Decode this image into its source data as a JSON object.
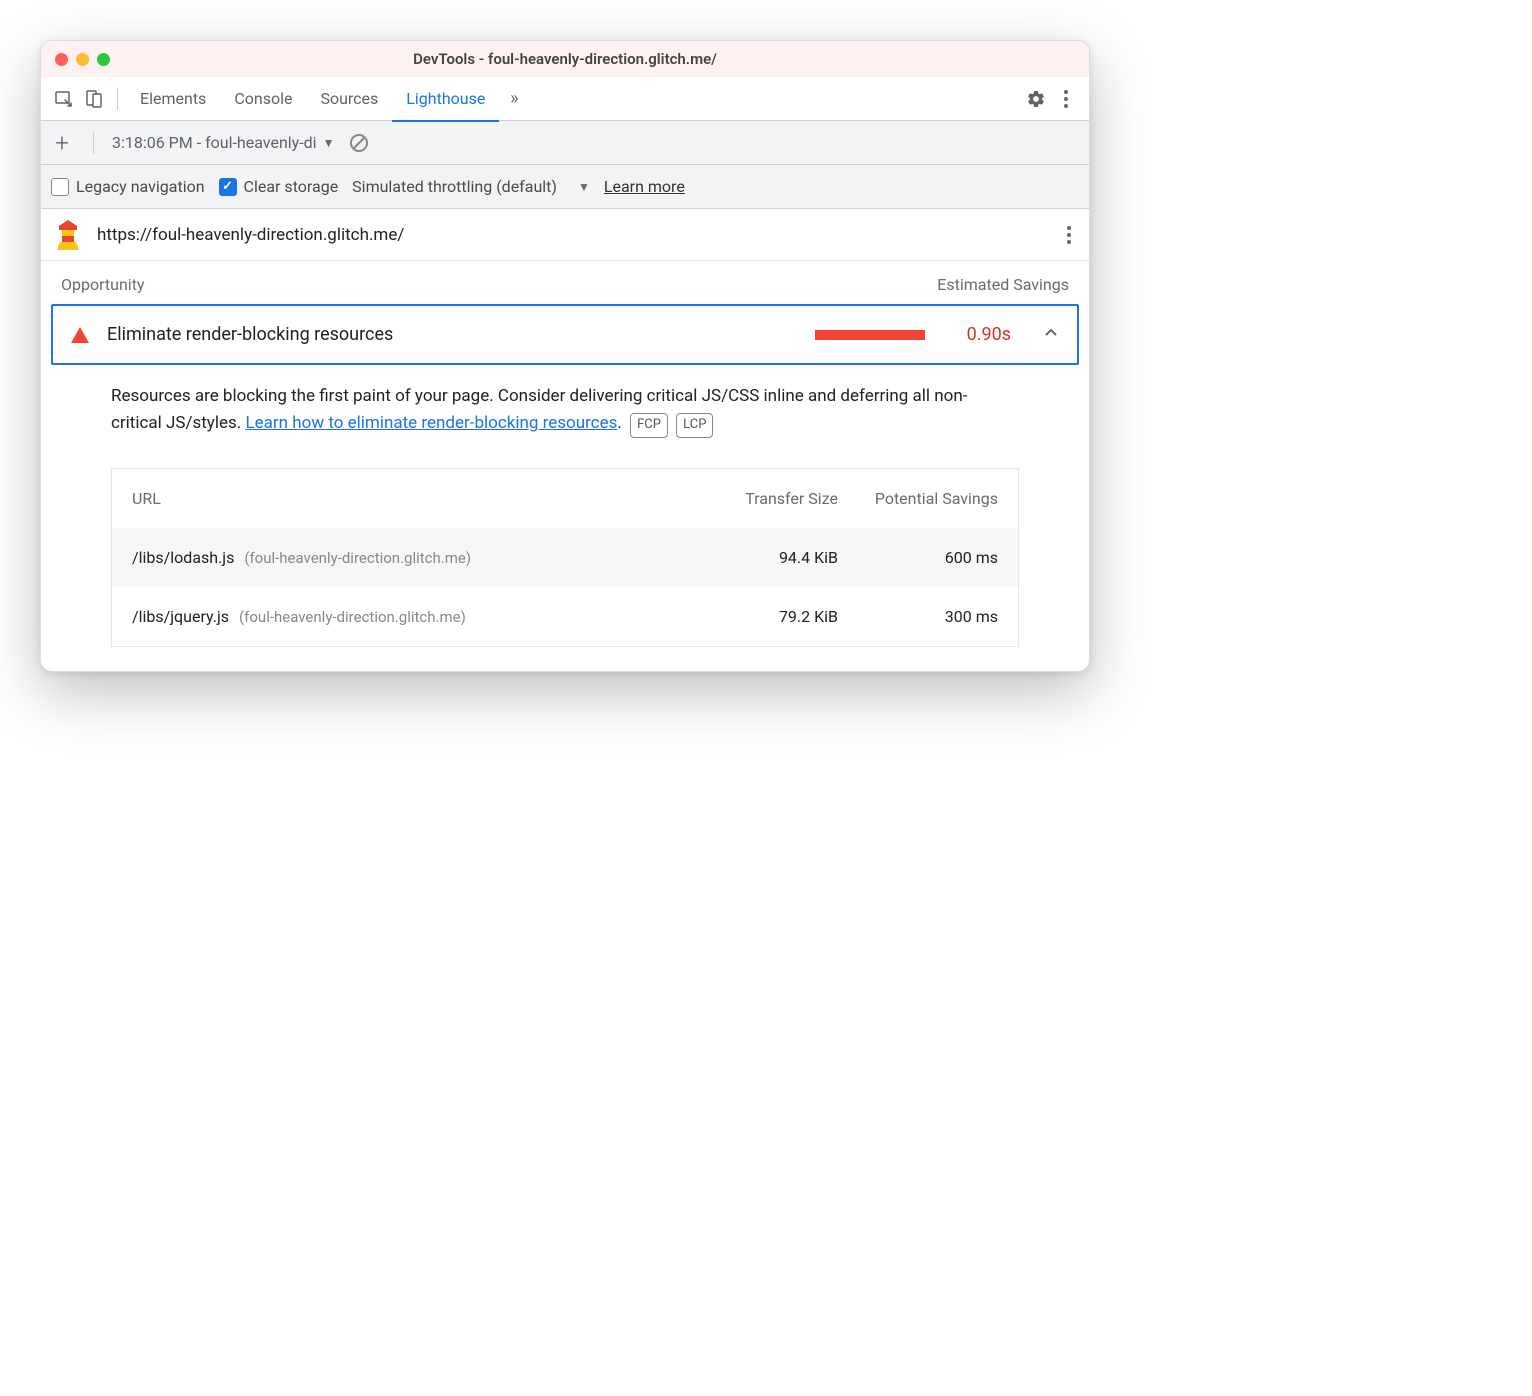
{
  "window": {
    "title": "DevTools - foul-heavenly-direction.glitch.me/"
  },
  "tabs": {
    "items": [
      "Elements",
      "Console",
      "Sources",
      "Lighthouse"
    ],
    "active": "Lighthouse"
  },
  "toolbar": {
    "report_label": "3:18:06 PM - foul-heavenly-di"
  },
  "options": {
    "legacy_label": "Legacy navigation",
    "legacy_checked": false,
    "clear_label": "Clear storage",
    "clear_checked": true,
    "throttling_label": "Simulated throttling (default)",
    "learn_more": "Learn more"
  },
  "report": {
    "url": "https://foul-heavenly-direction.glitch.me/"
  },
  "opportunities": {
    "header_left": "Opportunity",
    "header_right": "Estimated Savings",
    "item": {
      "title": "Eliminate render-blocking resources",
      "savings": "0.90s",
      "description_prefix": "Resources are blocking the first paint of your page. Consider delivering critical JS/CSS inline and deferring all non-critical JS/styles. ",
      "link_text": "Learn how to eliminate render-blocking resources",
      "description_suffix": ".",
      "badges": [
        "FCP",
        "LCP"
      ]
    },
    "table": {
      "headers": {
        "url": "URL",
        "size": "Transfer Size",
        "savings": "Potential Savings"
      },
      "rows": [
        {
          "path": "/libs/lodash.js",
          "origin": "(foul-heavenly-direction.glitch.me)",
          "size": "94.4 KiB",
          "savings": "600 ms"
        },
        {
          "path": "/libs/jquery.js",
          "origin": "(foul-heavenly-direction.glitch.me)",
          "size": "79.2 KiB",
          "savings": "300 ms"
        }
      ]
    }
  }
}
